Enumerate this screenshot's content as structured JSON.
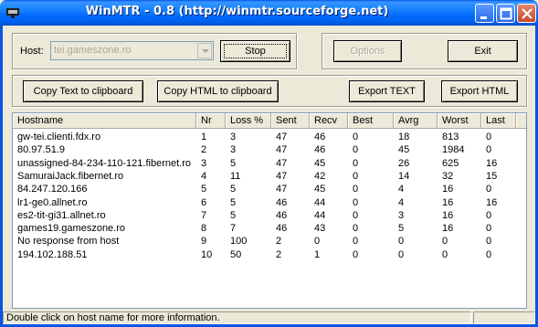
{
  "window": {
    "title": "WinMTR - 0.8 (http://winmtr.sourceforge.net)"
  },
  "controls": {
    "host_label": "Host:",
    "host_value": "tei.gameszone.ro",
    "stop_label": "Stop",
    "options_label": "Options",
    "exit_label": "Exit",
    "copy_text_label": "Copy Text to clipboard",
    "copy_html_label": "Copy HTML to clipboard",
    "export_text_label": "Export TEXT",
    "export_html_label": "Export HTML"
  },
  "table": {
    "columns": [
      "Hostname",
      "Nr",
      "Loss %",
      "Sent",
      "Recv",
      "Best",
      "Avrg",
      "Worst",
      "Last"
    ],
    "rows": [
      [
        "gw-tei.clienti.fdx.ro",
        "1",
        "3",
        "47",
        "46",
        "0",
        "18",
        "813",
        "0"
      ],
      [
        "80.97.51.9",
        "2",
        "3",
        "47",
        "46",
        "0",
        "45",
        "1984",
        "0"
      ],
      [
        "unassigned-84-234-110-121.fibernet.ro",
        "3",
        "5",
        "47",
        "45",
        "0",
        "26",
        "625",
        "16"
      ],
      [
        "SamuraiJack.fibernet.ro",
        "4",
        "11",
        "47",
        "42",
        "0",
        "14",
        "32",
        "15"
      ],
      [
        "84.247.120.166",
        "5",
        "5",
        "47",
        "45",
        "0",
        "4",
        "16",
        "0"
      ],
      [
        "lr1-ge0.allnet.ro",
        "6",
        "5",
        "46",
        "44",
        "0",
        "4",
        "16",
        "16"
      ],
      [
        "es2-tit-gi31.allnet.ro",
        "7",
        "5",
        "46",
        "44",
        "0",
        "3",
        "16",
        "0"
      ],
      [
        "games19.gameszone.ro",
        "8",
        "7",
        "46",
        "43",
        "0",
        "5",
        "16",
        "0"
      ],
      [
        "No response from host",
        "9",
        "100",
        "2",
        "0",
        "0",
        "0",
        "0",
        "0"
      ],
      [
        "194.102.188.51",
        "10",
        "50",
        "2",
        "1",
        "0",
        "0",
        "0",
        "0"
      ]
    ]
  },
  "statusbar": {
    "text": "Double click on host name for more information."
  },
  "icons": {
    "app": "app-icon",
    "minimize": "minimize-icon",
    "maximize": "maximize-icon",
    "close": "close-icon",
    "dropdown": "chevron-down-icon"
  },
  "colors": {
    "titlebar": "#0a55e0",
    "close_button": "#c44a2a"
  }
}
